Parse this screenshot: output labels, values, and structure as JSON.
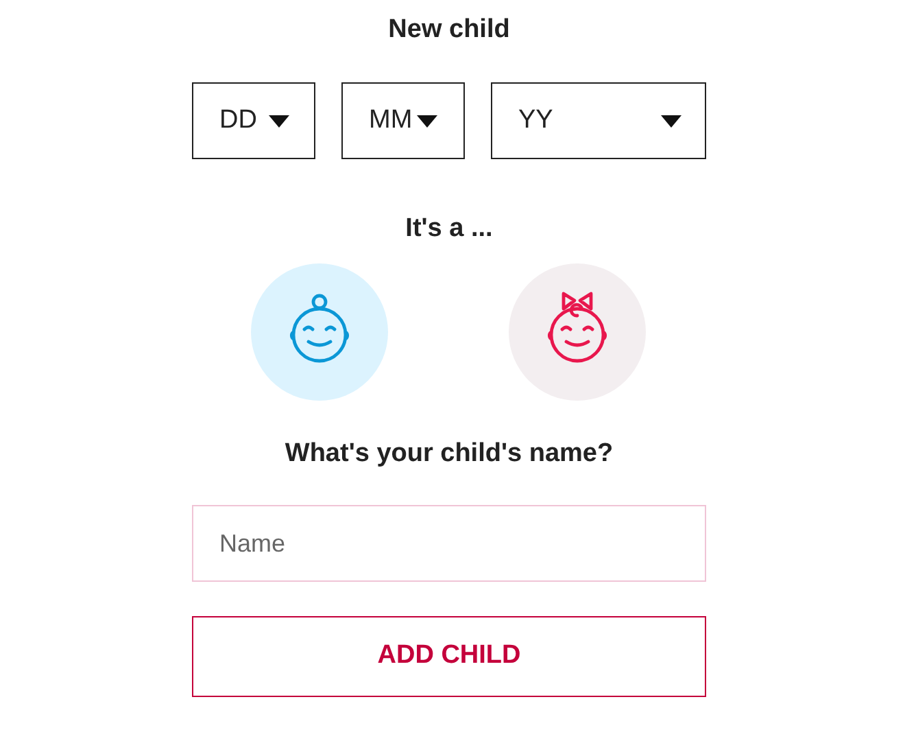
{
  "title": "New child",
  "date_selects": [
    {
      "placeholder": "DD"
    },
    {
      "placeholder": "MM"
    },
    {
      "placeholder": "YY"
    }
  ],
  "gender_prompt": "It's a ...",
  "genders": [
    {
      "kind": "boy",
      "selected": false
    },
    {
      "kind": "girl",
      "selected": false
    }
  ],
  "name_prompt": "What's your child's name?",
  "name_field": {
    "placeholder": "Name"
  },
  "submit_button": "ADD CHILD"
}
